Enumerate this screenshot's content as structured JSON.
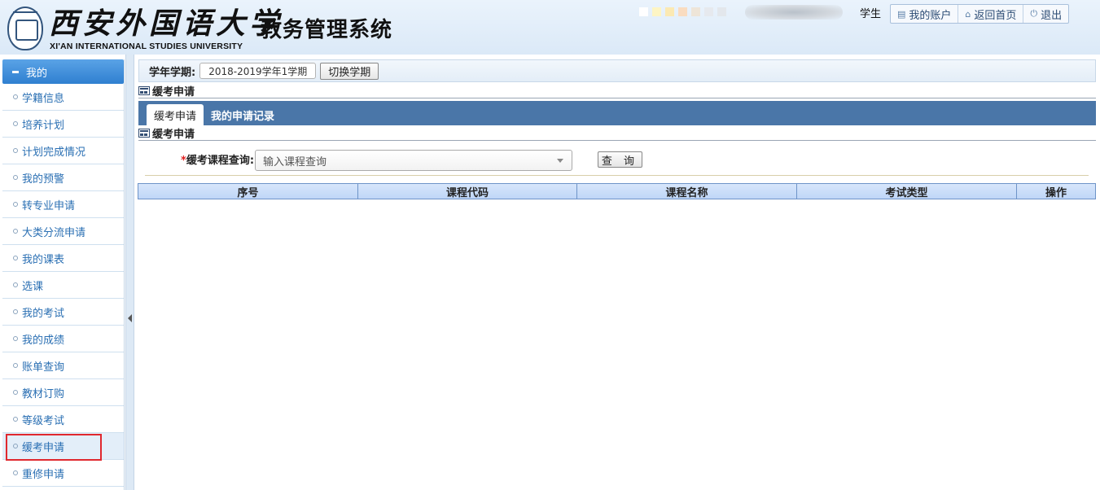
{
  "header": {
    "logo_cn": "西安外国语大学",
    "logo_en": "XI'AN INTERNATIONAL STUDIES UNIVERSITY",
    "system_title": "教务管理系统",
    "role": "学生",
    "swatch_colors": [
      "#ffffff",
      "#fdf5c4",
      "#fbe9b3",
      "#f9dcc0",
      "#eee5d8",
      "#e6e9ee",
      "#e3e7ec"
    ],
    "links": [
      {
        "icon": "account-icon",
        "label": "我的账户"
      },
      {
        "icon": "home-icon",
        "label": "返回首页"
      },
      {
        "icon": "power-icon",
        "label": "退出"
      }
    ]
  },
  "sidebar": {
    "header": "我的",
    "items": [
      {
        "label": "学籍信息"
      },
      {
        "label": "培养计划"
      },
      {
        "label": "计划完成情况"
      },
      {
        "label": "我的预警"
      },
      {
        "label": "转专业申请"
      },
      {
        "label": "大类分流申请"
      },
      {
        "label": "我的课表"
      },
      {
        "label": "选课"
      },
      {
        "label": "我的考试"
      },
      {
        "label": "我的成绩"
      },
      {
        "label": "账单查询"
      },
      {
        "label": "教材订购"
      },
      {
        "label": "等级考试"
      },
      {
        "label": "缓考申请"
      },
      {
        "label": "重修申请"
      }
    ],
    "active_index": 13
  },
  "term": {
    "label": "学年学期:",
    "value": "2018-2019学年1学期",
    "switch_label": "切换学期"
  },
  "section_title": "缓考申请",
  "tabs": [
    {
      "label": "缓考申请",
      "active": true
    },
    {
      "label": "我的申请记录",
      "active": false
    }
  ],
  "sub_section_title": "缓考申请",
  "query": {
    "required_mark": "*",
    "label": "缓考课程查询:",
    "placeholder": "输入课程查询",
    "button_label": "查 询"
  },
  "table": {
    "columns": [
      "序号",
      "课程代码",
      "课程名称",
      "考试类型",
      "操作"
    ]
  }
}
